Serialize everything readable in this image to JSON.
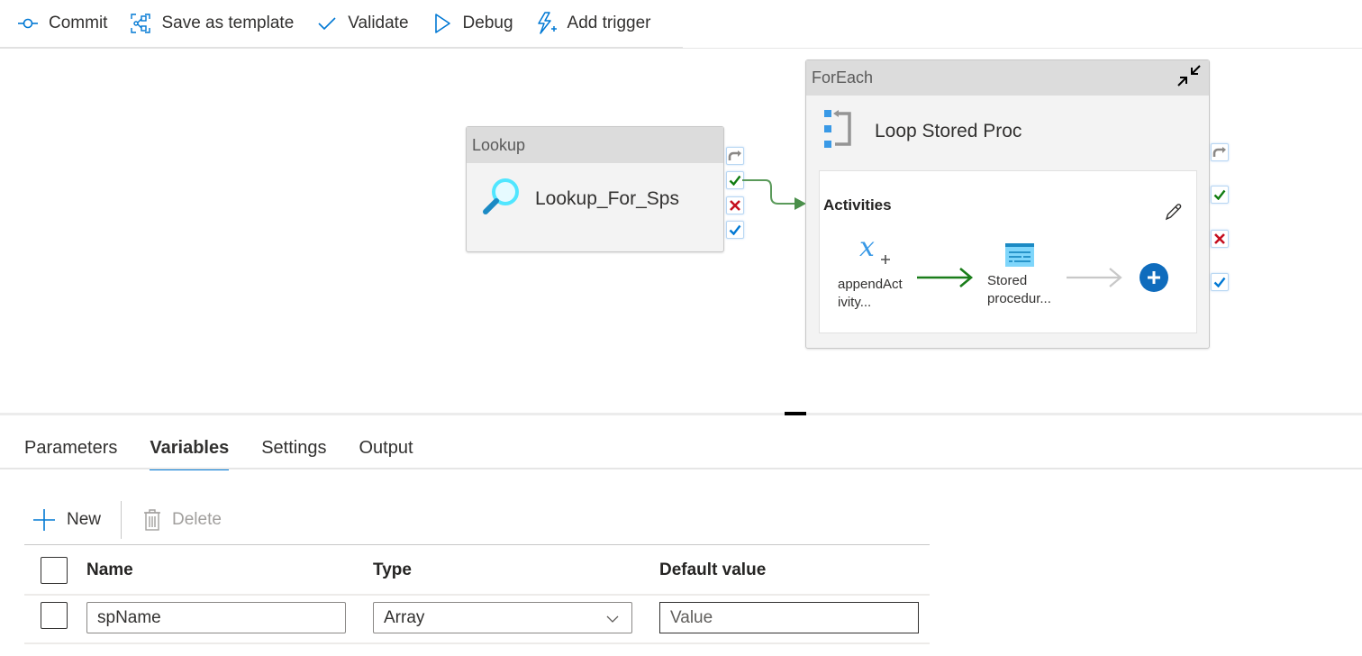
{
  "toolbar": {
    "commit": "Commit",
    "save_template": "Save as template",
    "validate": "Validate",
    "debug": "Debug",
    "add_trigger": "Add trigger"
  },
  "canvas": {
    "lookup": {
      "type": "Lookup",
      "name": "Lookup_For_Sps"
    },
    "foreach": {
      "type": "ForEach",
      "name": "Loop Stored Proc",
      "activities_label": "Activities",
      "inner": [
        {
          "name_line1": "appendAct",
          "name_line2": "ivity...",
          "icon": "append-variable-icon"
        },
        {
          "name_line1": "Stored",
          "name_line2": "procedur...",
          "icon": "stored-procedure-icon"
        }
      ]
    },
    "colors": {
      "success": "#107c10",
      "failure": "#c50f1f",
      "completion": "#0078d4",
      "skip": "#8a8886",
      "accent": "#0078d4"
    }
  },
  "panel": {
    "tabs": [
      {
        "label": "Parameters",
        "active": false
      },
      {
        "label": "Variables",
        "active": true
      },
      {
        "label": "Settings",
        "active": false
      },
      {
        "label": "Output",
        "active": false
      }
    ],
    "commands": {
      "new": "New",
      "delete": "Delete"
    },
    "table": {
      "columns": [
        "Name",
        "Type",
        "Default value"
      ],
      "rows": [
        {
          "name": "spName",
          "type": "Array",
          "default_placeholder": "Value"
        }
      ]
    }
  }
}
